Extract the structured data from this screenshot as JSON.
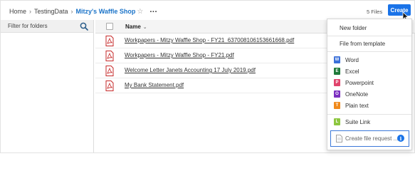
{
  "breadcrumb": {
    "home": "Home",
    "testing": "TestingData",
    "current": "Mitzy's Waffle Shop"
  },
  "header": {
    "files_count": "5 Files",
    "create_label": "Create"
  },
  "sidebar": {
    "filter_placeholder": "Filter for folders"
  },
  "table": {
    "name_header": "Name",
    "rows": [
      {
        "name": "Workpapers - Mitzy Waffle Shop - FY21_637008106153661668.pdf",
        "icon": "pdf-icon"
      },
      {
        "name": "Workpapers - Mitzy Waffle Shop - FY21.pdf",
        "icon": "pdf-icon"
      },
      {
        "name": "Welcome Letter Janets Accounting 17 July 2019.pdf",
        "icon": "pdf-icon"
      },
      {
        "name": "My Bank Statement.pdf",
        "icon": "pdf-icon"
      }
    ]
  },
  "menu": {
    "new_folder": "New folder",
    "file_from_template": "File from template",
    "word": "Word",
    "excel": "Excel",
    "powerpoint": "Powerpoint",
    "onenote": "OneNote",
    "plain_text": "Plain text",
    "suite_link": "Suite Link",
    "create_request": "Create file request ...",
    "icon_letters": {
      "word": "W",
      "excel": "E",
      "powerpoint": "P",
      "onenote": "O",
      "plain_text": "T",
      "suite_link": "L"
    }
  },
  "colors": {
    "accent": "#1a73e8",
    "word": "#3a6fd8",
    "excel": "#1f7a3a",
    "powerpoint": "#e0436b",
    "onenote": "#7b2fc0",
    "plain_text": "#f08a1c",
    "suite_link": "#8dc63f",
    "pdf": "#c62828"
  }
}
